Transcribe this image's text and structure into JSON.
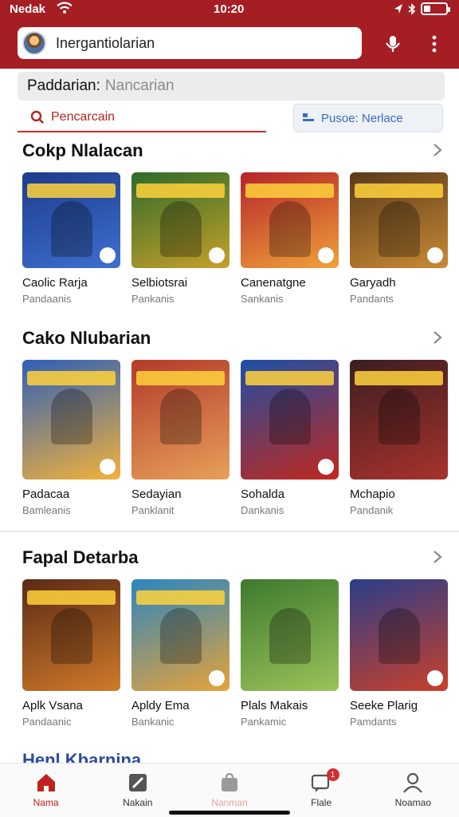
{
  "status": {
    "carrier": "Nedak",
    "time": "10:20"
  },
  "header": {
    "search_text": "Inergantiolarian"
  },
  "filter": {
    "label": "Paddarian:",
    "placeholder": "Nancarian"
  },
  "search_button": {
    "label": "Pencarcain"
  },
  "filter_button": {
    "label": "Pusoe: Nerlace"
  },
  "sections": [
    {
      "title": "Cokp Nlalacan",
      "games": [
        {
          "name": "Caolic Rarja",
          "sub": "Pandaanis",
          "c1": "#1d3c8c",
          "c2": "#3e6fd0"
        },
        {
          "name": "Selbiotsrai",
          "sub": "Pankanis",
          "c1": "#2e6b2a",
          "c2": "#c7a02a"
        },
        {
          "name": "Canenatgne",
          "sub": "Sankanis",
          "c1": "#b5242a",
          "c2": "#f0a23a"
        },
        {
          "name": "Garyadh",
          "sub": "Pandants",
          "c1": "#5a3a1c",
          "c2": "#c98a34"
        }
      ]
    },
    {
      "title": "Cako Nlubarian",
      "games": [
        {
          "name": "Padacaa",
          "sub": "Bamleanis",
          "c1": "#2e5fb8",
          "c2": "#f2b23a"
        },
        {
          "name": "Sedayian",
          "sub": "Panklanit",
          "c1": "#b33a2a",
          "c2": "#e7a05a"
        },
        {
          "name": "Sohalda",
          "sub": "Dankanis",
          "c1": "#1e4fa6",
          "c2": "#c0281e"
        },
        {
          "name": "Mchapio",
          "sub": "Pandanik",
          "c1": "#3b1e22",
          "c2": "#a8322c"
        }
      ]
    },
    {
      "title": "Fapal Detarba",
      "games": [
        {
          "name": "Aplk Vsana",
          "sub": "Pandaanic",
          "c1": "#5a2a16",
          "c2": "#d07a2a"
        },
        {
          "name": "Apldy Ema",
          "sub": "Bankanic",
          "c1": "#2a86c0",
          "c2": "#e6a23a"
        },
        {
          "name": "Plals Makais",
          "sub": "Pankamic",
          "c1": "#3d7a2e",
          "c2": "#9cc25a"
        },
        {
          "name": "Seeke Plarig",
          "sub": "Pamdants",
          "c1": "#2a3e8a",
          "c2": "#c8402a"
        }
      ]
    }
  ],
  "peek_title": "Henl Kbarnina",
  "nav": [
    {
      "label": "Nama"
    },
    {
      "label": "Nakain"
    },
    {
      "label": "Nanman"
    },
    {
      "label": "Flale",
      "badge": "1"
    },
    {
      "label": "Noamao"
    }
  ],
  "colors": {
    "brand": "#a51e23",
    "accent": "#c0221f",
    "link": "#3b6cc0"
  }
}
